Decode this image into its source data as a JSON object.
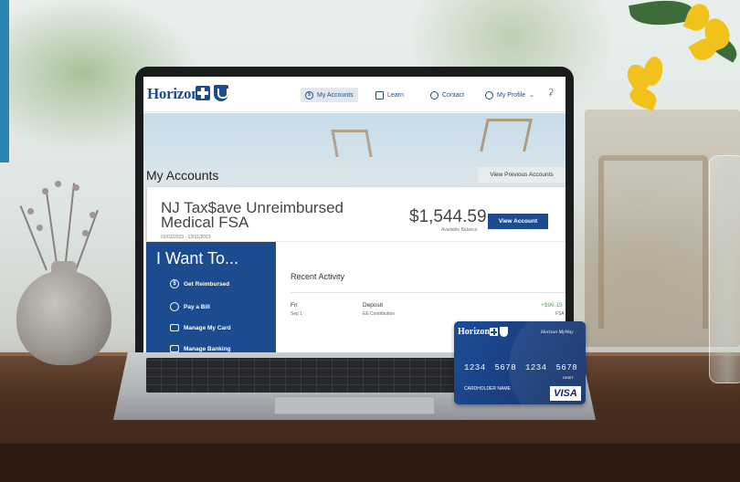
{
  "header": {
    "logo_text": "Horizon",
    "nav": [
      {
        "label": "My Accounts",
        "icon": "dollar-circle-icon",
        "active": true
      },
      {
        "label": "Learn",
        "icon": "book-icon",
        "active": false
      },
      {
        "label": "Contact",
        "icon": "phone-icon",
        "active": false
      },
      {
        "label": "My Profile",
        "icon": "user-circle-icon",
        "active": false
      }
    ]
  },
  "page": {
    "title": "My Accounts",
    "previous_accounts_label": "View Previous Accounts"
  },
  "account": {
    "name": "NJ Tax$ave Unreimbursed Medical FSA",
    "dates": "01/01/2023 - 12/31/2023",
    "balance": "$1,544.59",
    "balance_label": "Available Balance",
    "view_label": "View Account"
  },
  "want": {
    "title": "I Want To...",
    "items": [
      {
        "label": "Get Reimbursed",
        "icon": "dollar-icon"
      },
      {
        "label": "Pay a Bill",
        "icon": "hand-money-icon"
      },
      {
        "label": "Manage My Card",
        "icon": "card-icon"
      },
      {
        "label": "Manage Banking",
        "icon": "bank-icon"
      }
    ]
  },
  "activity": {
    "title": "Recent Activity",
    "rows": [
      {
        "day": "Fri",
        "date": "Sep 1",
        "type": "Deposit",
        "detail": "EE Contribution",
        "amount": "+$96.15",
        "account": "FSA"
      }
    ]
  },
  "card": {
    "logo_text": "Horizon",
    "brand": "Horizon MyWay",
    "number": "1234 5678 1234 5678",
    "debit_label": "DEBIT",
    "holder": "CARDHOLDER NAME",
    "network": "VISA"
  },
  "colors": {
    "brand_blue": "#1d4b8f",
    "positive_green": "#5aa469",
    "visa_blue": "#1a1f71"
  }
}
